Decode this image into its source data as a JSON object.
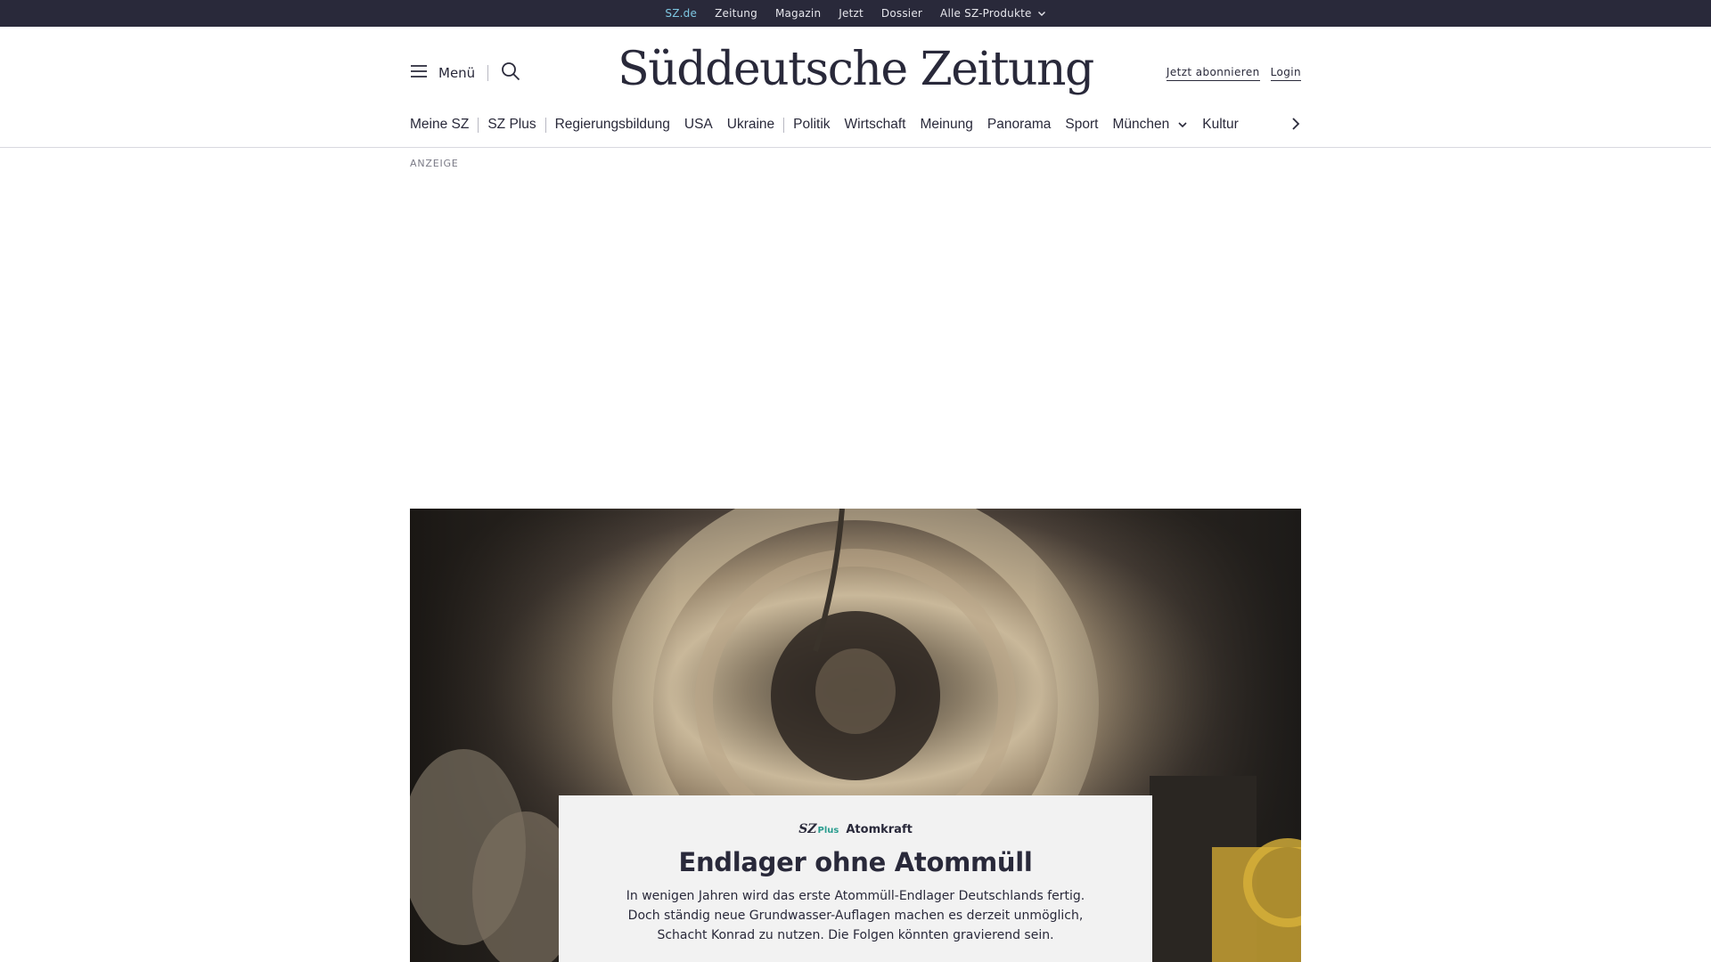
{
  "topbar": {
    "links": [
      "SZ.de",
      "Zeitung",
      "Magazin",
      "Jetzt",
      "Dossier"
    ],
    "products_label": "Alle SZ-Produkte",
    "active": "SZ.de"
  },
  "header": {
    "menu_label": "Menü",
    "logo_text": "Süddeutsche Zeitung",
    "subscribe_label": "Jetzt abonnieren",
    "login_label": "Login"
  },
  "nav": {
    "items": [
      "Meine SZ",
      "SZ Plus",
      "Regierungsbildung",
      "USA",
      "Ukraine",
      "Politik",
      "Wirtschaft",
      "Meinung",
      "Panorama",
      "Sport",
      "München",
      "Kultur"
    ]
  },
  "ad": {
    "label": "ANZEIGE"
  },
  "hero": {
    "badge_sz": "SZ",
    "badge_plus": "Plus",
    "kicker": "Atomkraft",
    "title": "Endlager ohne Atommüll",
    "text": "In wenigen Jahren wird das erste Atommüll-Endlager Deutschlands fertig. Doch ständig neue Grundwasser-Auflagen machen es derzeit unmöglich, Schacht Konrad zu nutzen. Die Folgen könnten gravierend sein."
  },
  "colors": {
    "topbar_bg": "#29293a",
    "active_link": "#7ec8e3",
    "plus_accent": "#2a9d8f",
    "teaser_bg": "#f2f2f2"
  }
}
